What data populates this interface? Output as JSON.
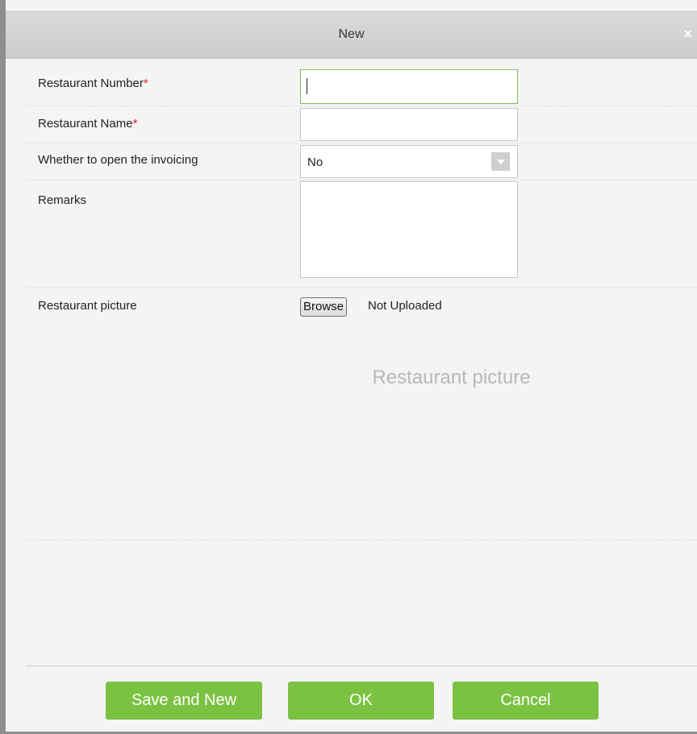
{
  "dialog": {
    "title": "New",
    "close_icon": "×"
  },
  "form": {
    "restaurant_number": {
      "label": "Restaurant Number",
      "required_mark": "*",
      "value": ""
    },
    "restaurant_name": {
      "label": "Restaurant Name",
      "required_mark": "*",
      "value": ""
    },
    "invoicing": {
      "label": "Whether to open the invoicing",
      "value": "No"
    },
    "remarks": {
      "label": "Remarks",
      "value": ""
    },
    "picture": {
      "label": "Restaurant picture",
      "browse_label": "Browse",
      "status": "Not Uploaded",
      "placeholder": "Restaurant picture"
    }
  },
  "buttons": {
    "save_new": "Save and New",
    "ok": "OK",
    "cancel": "Cancel"
  },
  "colors": {
    "button_green": "#7cc242",
    "focus_border": "#7cbf5a",
    "required": "#e02020"
  }
}
